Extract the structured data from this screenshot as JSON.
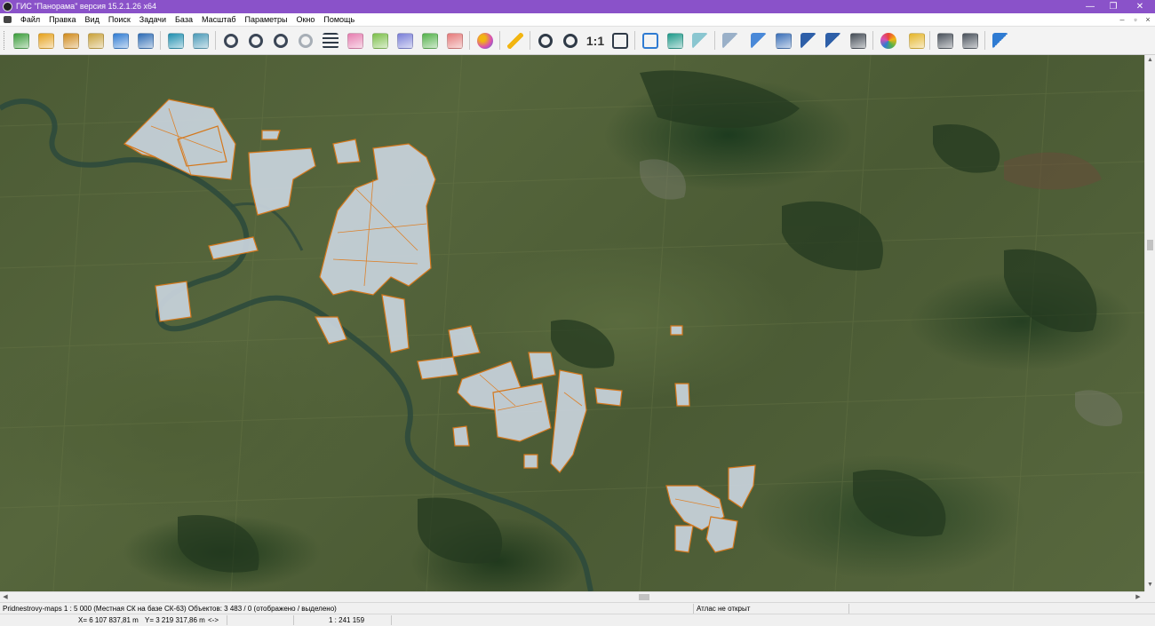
{
  "window": {
    "title": "ГИС \"Панорама\" версия 15.2.1.26 x64",
    "controls": {
      "minimize": "—",
      "maximize": "❐",
      "close": "✕"
    }
  },
  "menu": {
    "items": [
      "Файл",
      "Правка",
      "Вид",
      "Поиск",
      "Задачи",
      "База",
      "Масштаб",
      "Параметры",
      "Окно",
      "Помощь"
    ],
    "mdi": {
      "minimize": "–",
      "restore": "▫",
      "close": "×"
    }
  },
  "toolbar": {
    "scale_one_label": "1:1",
    "buttons": [
      {
        "name": "new-document-icon",
        "color": "#3a9d3a"
      },
      {
        "name": "open-folder-icon",
        "color": "#e6a21c"
      },
      {
        "name": "open-multiple-icon",
        "color": "#d08a1a"
      },
      {
        "name": "database-icon",
        "color": "#c9a23a"
      },
      {
        "name": "globe-refresh-icon",
        "color": "#2f7bd2"
      },
      {
        "name": "map-document-icon",
        "color": "#2c6bb5"
      },
      {
        "name": "layers-icon",
        "color": "#1f8fb0"
      },
      {
        "name": "layer-tree-icon",
        "color": "#4a9ab8"
      },
      {
        "name": "binoculars-icon",
        "color": "#3b4656"
      },
      {
        "name": "binoculars-text-icon",
        "color": "#3b4656"
      },
      {
        "name": "binoculars-more-icon",
        "color": "#3b4656"
      },
      {
        "name": "binoculars-disabled-icon",
        "color": "#a7aeb6"
      },
      {
        "name": "list-icon",
        "color": "#2f3a47"
      },
      {
        "name": "erase-object-icon",
        "color": "#e67eb0"
      },
      {
        "name": "edit-object-icon",
        "color": "#7cc04a"
      },
      {
        "name": "add-point-icon",
        "color": "#7a7fd8"
      },
      {
        "name": "check-object-icon",
        "color": "#53b24a"
      },
      {
        "name": "delete-object-icon",
        "color": "#e57a7a"
      },
      {
        "name": "palette-icon",
        "color": "#d94fb3"
      },
      {
        "name": "lightning-icon",
        "color": "#f2b511"
      },
      {
        "name": "zoom-out-icon",
        "color": "#2f3a47"
      },
      {
        "name": "zoom-in-icon",
        "color": "#2f3a47"
      },
      {
        "name": "fit-extent-icon",
        "color": "#2f3a47"
      },
      {
        "name": "select-frame-icon",
        "color": "#2f7bd2"
      },
      {
        "name": "select-check-icon",
        "color": "#1d9a8a"
      },
      {
        "name": "back-arrow-icon",
        "color": "#8ac6d0"
      },
      {
        "name": "pointer-icon",
        "color": "#9ab0c8"
      },
      {
        "name": "map-pointer-icon",
        "color": "#4a89d8"
      },
      {
        "name": "map-window-icon",
        "color": "#3a6fb8"
      },
      {
        "name": "window-pointer-icon",
        "color": "#2e5fa8"
      },
      {
        "name": "window-pointer-2-icon",
        "color": "#2e5fa8"
      },
      {
        "name": "text-document-icon",
        "color": "#444c56"
      },
      {
        "name": "color-wheel-icon",
        "color": "#e8443a"
      },
      {
        "name": "route-icon",
        "color": "#e5b62a"
      },
      {
        "name": "printer-icon",
        "color": "#4a525c"
      },
      {
        "name": "printer-settings-icon",
        "color": "#4a525c"
      },
      {
        "name": "help-pointer-icon",
        "color": "#2f7bd2"
      }
    ]
  },
  "status": {
    "map_info": "Pridnestrovy-maps  1 : 5 000 (Местная СК на базе СК-63) Объектов: 3 483 / 0 (отображено / выделено)",
    "atlas": "Атлас не открыт",
    "x_coord": "X= 6 107 837,81 m",
    "y_coord": "Y= 3 219 317,86 m",
    "arrows": "<->",
    "scale": "1 : 241 159"
  },
  "colors": {
    "title_bar": "#8a52c9",
    "parcel_fill": "#c9d4dd",
    "parcel_border": "#e07a1a",
    "river": "#2e4a3c"
  }
}
